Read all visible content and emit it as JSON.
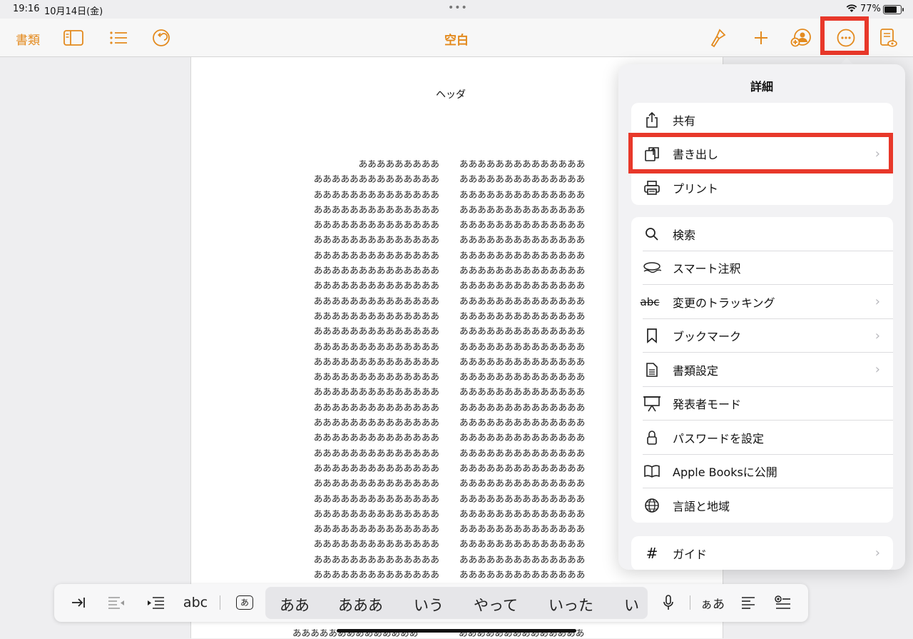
{
  "status_bar": {
    "time": "19:16",
    "date": "10月14日(金)",
    "dots": "•••",
    "battery_percent": "77%",
    "battery_level": 0.77
  },
  "toolbar": {
    "documents_label": "書類",
    "title": "空白"
  },
  "document": {
    "header": "ヘッダ",
    "left_column": [
      "あああああああああ",
      "ああああああああああああああ",
      "ああああああああああああああ",
      "ああああああああああああああ",
      "ああああああああああああああ",
      "ああああああああああああああ",
      "ああああああああああああああ",
      "ああああああああああああああ",
      "ああああああああああああああ",
      "ああああああああああああああ",
      "ああああああああああああああ",
      "ああああああああああああああ",
      "ああああああああああああああ",
      "ああああああああああああああ",
      "ああああああああああああああ",
      "ああああああああああああああ",
      "ああああああああああああああ",
      "ああああああああああああああ",
      "ああああああああああああああ",
      "ああああああああああああああ",
      "ああああああああああああああ",
      "ああああああああああああああ",
      "ああああああああああああああ",
      "ああああああああああああああ",
      "ああああああああああああああ",
      "ああああああああああああああ",
      "ああああああああああああああ",
      "ああああああああああああああ"
    ],
    "right_column": [
      "ああああああああああああああ",
      "ああああああああああああああ",
      "ああああああああああああああ",
      "ああああああああああああああ",
      "ああああああああああああああ",
      "ああああああああああああああ",
      "ああああああああああああああ",
      "ああああああああああああああ",
      "ああああああああああああああ",
      "ああああああああああああああ",
      "ああああああああああああああ",
      "ああああああああああああああ",
      "ああああああああああああああ",
      "ああああああああああああああ",
      "ああああああああああああああ",
      "ああああああああああああああ",
      "ああああああああああああああ",
      "ああああああああああああああ",
      "ああああああああああああああ",
      "ああああああああああああああ",
      "ああああああああああああああ",
      "ああああああああああああああ",
      "ああああああああああああああ",
      "ああああああああああああああ",
      "ああああああああああああああ",
      "ああああああああああああああ",
      "ああああああああああああああ",
      "ああああああああああああああ"
    ],
    "bottom_left": "ああああああああああああああ",
    "bottom_right": "ああああああああああああああ"
  },
  "popover": {
    "title": "詳細",
    "group1": [
      {
        "label": "共有",
        "icon": "share-icon",
        "chevron": false
      },
      {
        "label": "書き出し",
        "icon": "export-icon",
        "chevron": true
      },
      {
        "label": "プリント",
        "icon": "printer-icon",
        "chevron": false
      }
    ],
    "group2": [
      {
        "label": "検索",
        "icon": "search-icon",
        "chevron": false
      },
      {
        "label": "スマート注釈",
        "icon": "smart-annotation-icon",
        "chevron": false
      },
      {
        "label": "変更のトラッキング",
        "icon": "track-changes-icon",
        "chevron": true
      },
      {
        "label": "ブックマーク",
        "icon": "bookmark-icon",
        "chevron": true
      },
      {
        "label": "書類設定",
        "icon": "document-settings-icon",
        "chevron": true
      },
      {
        "label": "発表者モード",
        "icon": "presenter-mode-icon",
        "chevron": false
      },
      {
        "label": "パスワードを設定",
        "icon": "lock-icon",
        "chevron": false
      },
      {
        "label": "Apple Booksに公開",
        "icon": "book-icon",
        "chevron": false
      },
      {
        "label": "言語と地域",
        "icon": "globe-icon",
        "chevron": false
      }
    ],
    "group3": [
      {
        "label": "ガイド",
        "icon": "grid-hash-icon",
        "chevron": true
      }
    ],
    "track_icon_text": "abc"
  },
  "keyboard_bar": {
    "abc_label": "abc",
    "kana_label": "あ",
    "candidates": [
      "ああ",
      "あああ",
      "いう",
      "やって",
      "いった",
      "い"
    ],
    "script_label": "ぁあ"
  },
  "colors": {
    "accent": "#e38a1e",
    "highlight": "#e8382a"
  }
}
